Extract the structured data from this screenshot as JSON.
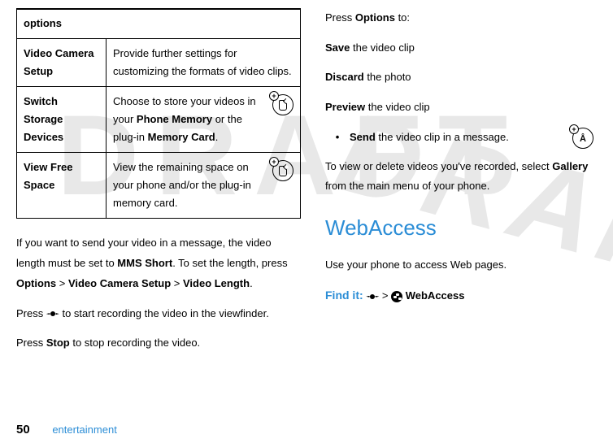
{
  "watermark": {
    "left": "DRAFT",
    "right": "DRAFT"
  },
  "table": {
    "header": "options",
    "rows": [
      {
        "name": "Video Camera Setup",
        "desc_pre": "Provide further settings for customizing the formats of video clips.",
        "has_icon": false
      },
      {
        "name": "Switch Storage Devices",
        "desc_pre": "Choose to store your videos in your ",
        "bold1": "Phone Memory",
        "mid": " or the plug-in ",
        "bold2": "Memory Card",
        "post": ".",
        "has_icon": true,
        "icon_glyph": "sd"
      },
      {
        "name": "View Free Space",
        "desc_pre": "View the remaining space on your phone and/or the plug-in memory card.",
        "has_icon": true,
        "icon_glyph": "sd"
      }
    ]
  },
  "left": {
    "p1_a": "If you want to send your video in a message, the video length must be set to ",
    "p1_b": "MMS Short",
    "p1_c": ". To set the length, press ",
    "p1_d": "Options",
    "p1_e": " > ",
    "p1_f": "Video Camera Setup",
    "p1_g": " > ",
    "p1_h": "Video Length",
    "p1_i": ".",
    "p2_a": "Press ",
    "p2_b": " to start recording the video in the viewfinder.",
    "p3_a": "Press ",
    "p3_b": "Stop",
    "p3_c": " to stop recording the video."
  },
  "right": {
    "l1_a": "Press ",
    "l1_b": "Options",
    "l1_c": " to:",
    "l2_a": "Save",
    "l2_b": " the video clip",
    "l3_a": "Discard",
    "l3_b": " the photo",
    "l4_a": "Preview",
    "l4_b": " the video clip",
    "bullet_a": "Send",
    "bullet_b": " the video clip in a message.",
    "p5_a": "To view or delete videos you've recorded, select ",
    "p5_b": "Gallery",
    "p5_c": " from the main menu of your phone.",
    "heading": "WebAccess",
    "p6": "Use your phone to access Web pages.",
    "find_label": "Find it:",
    "find_sep": " > ",
    "find_target": " WebAccess"
  },
  "footer": {
    "page": "50",
    "section": "entertainment"
  }
}
